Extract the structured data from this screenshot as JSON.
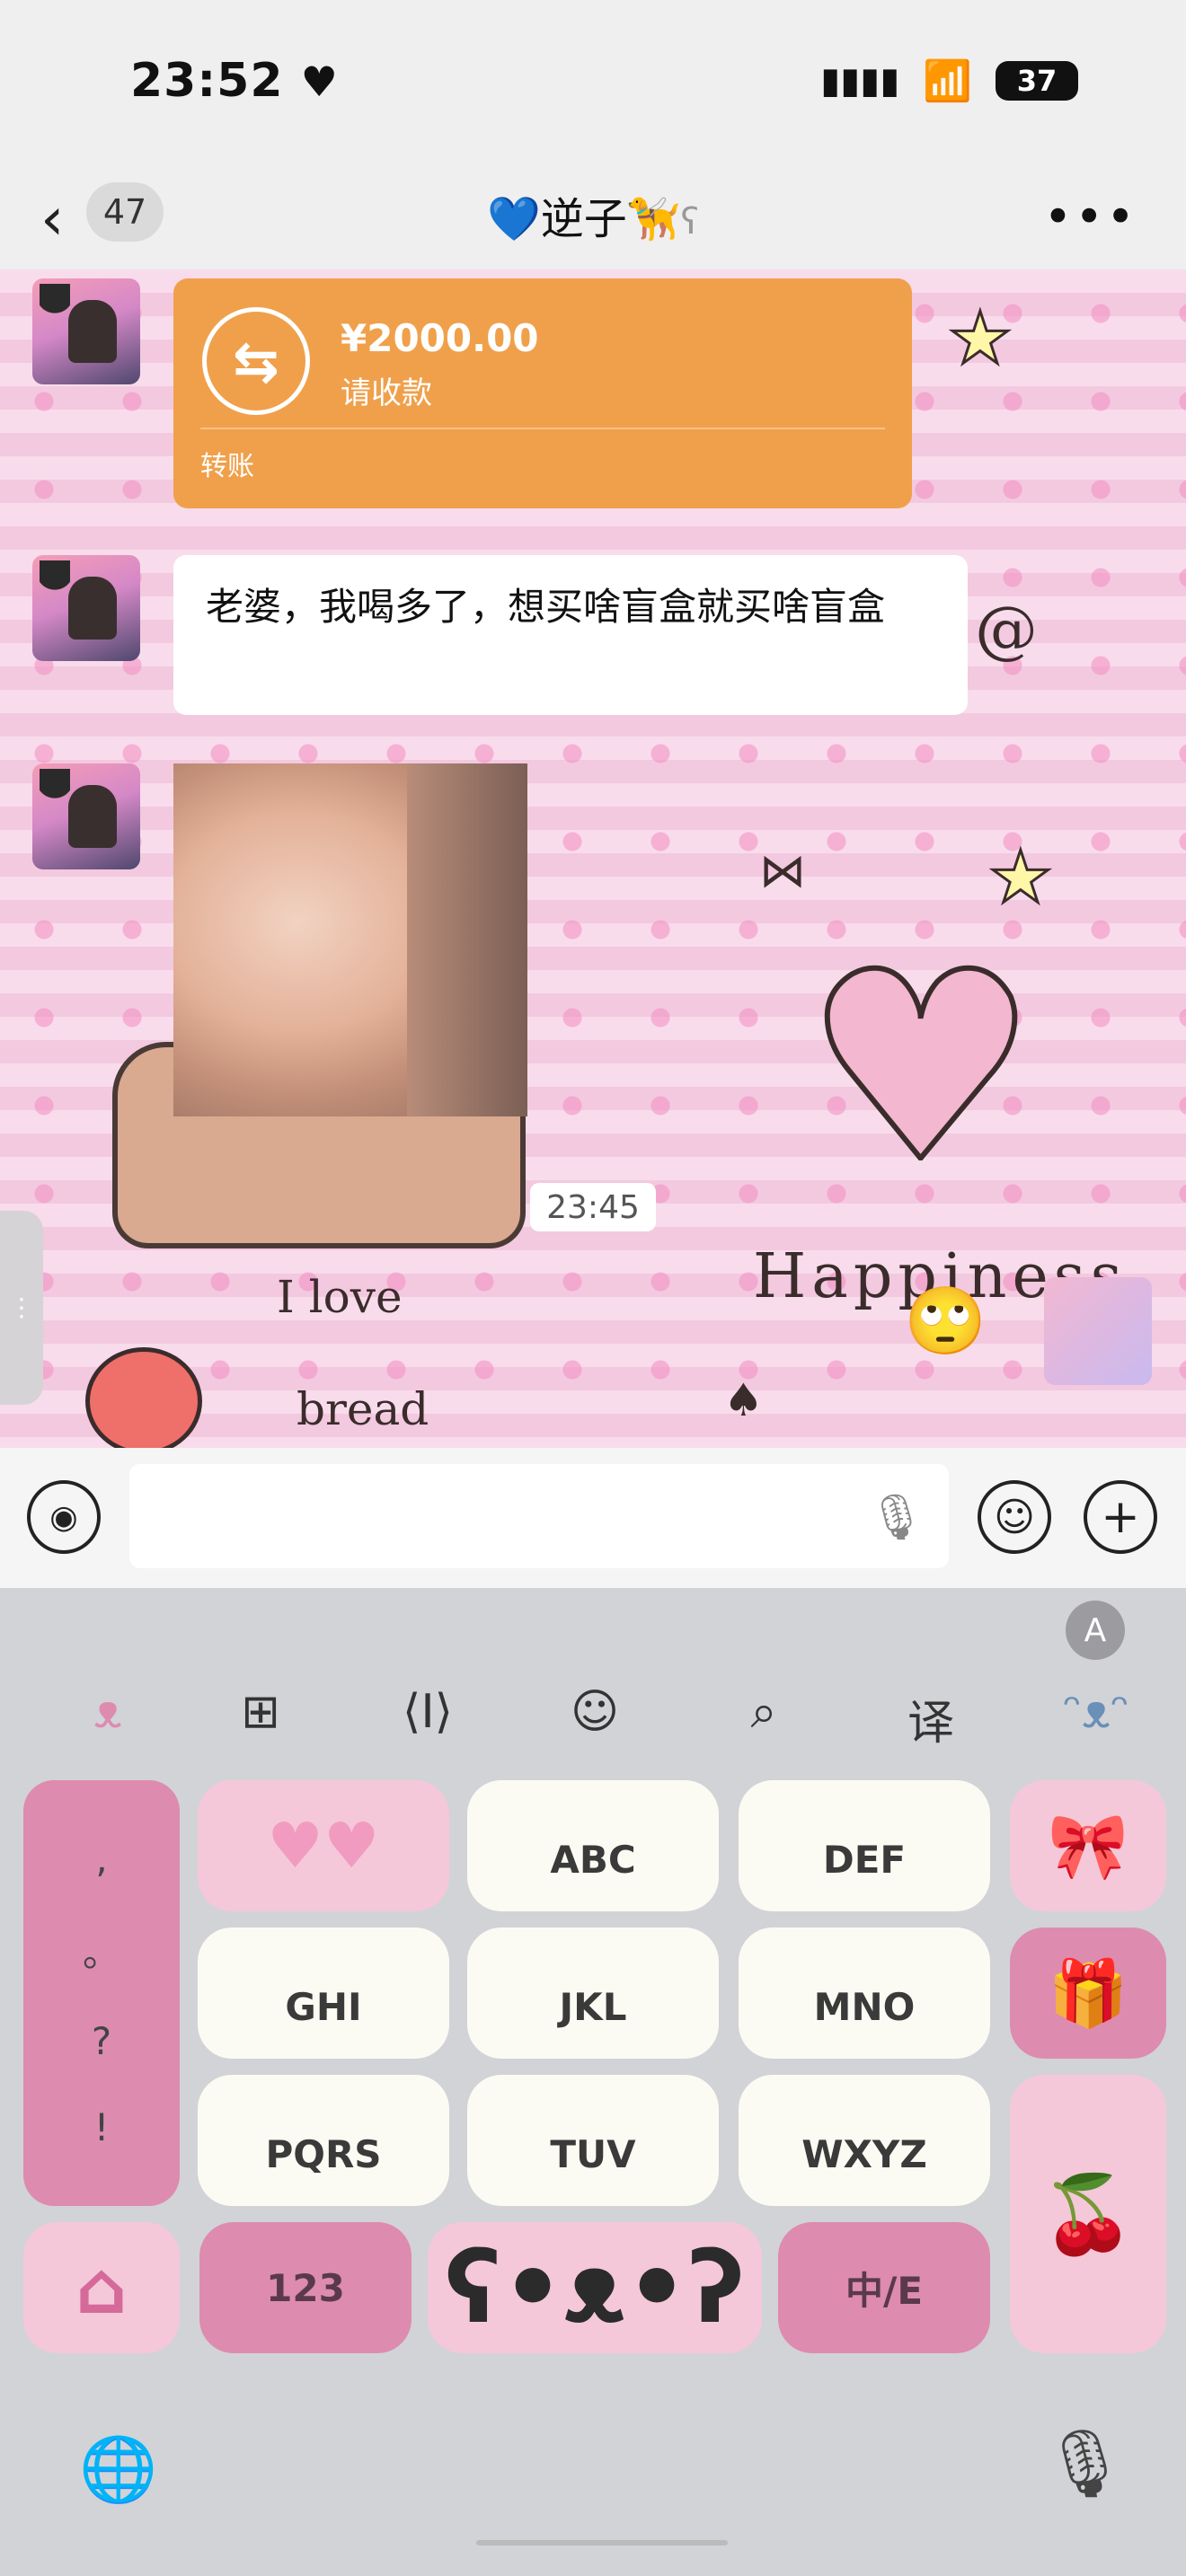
{
  "status_bar": {
    "time": "23:52",
    "heart": "♥",
    "battery": "37"
  },
  "nav": {
    "back_count": "47",
    "title": "💙逆子🦮",
    "ear_icon": "ear-icon"
  },
  "messages": {
    "transfer": {
      "amount": "¥2000.00",
      "request": "请收款",
      "footer": "转账"
    },
    "text": "老婆，我喝多了，想买啥盲盒就买啥盲盒",
    "timestamp": "23:45"
  },
  "wallpaper": {
    "text1": "I love",
    "text2": "bread",
    "text3": "Happiness"
  },
  "keyboard": {
    "punct": [
      ",",
      "。",
      "?",
      "!"
    ],
    "keys": {
      "abc": "ABC",
      "def": "DEF",
      "ghi": "GHI",
      "jkl": "JKL",
      "mno": "MNO",
      "pqrs": "PQRS",
      "tuv": "TUV",
      "wxyz": "WXYZ",
      "num": "123",
      "lang": "中/E"
    }
  },
  "colors": {
    "transfer_orange": "#f0a04b",
    "key_pink": "#de8bb0"
  }
}
